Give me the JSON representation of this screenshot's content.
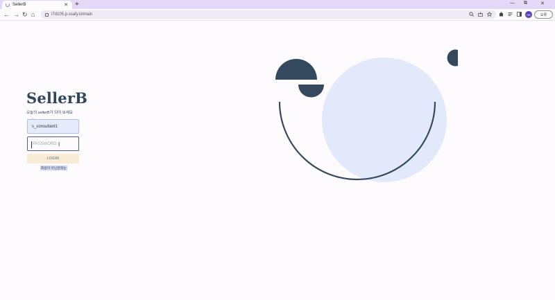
{
  "browser": {
    "tab_title": "SellerB",
    "tab_close": "✕",
    "new_tab": "+",
    "url": "i7d105.p.ssafy.io/main",
    "profile_initials": "RB",
    "update_label": "오류",
    "window_minimize": "—",
    "window_restore": "⧉",
    "window_close": "✕",
    "nav_back": "←",
    "nav_forward": "→",
    "nav_reload": "↻",
    "nav_home": "⌂"
  },
  "login": {
    "brand": "SellerB",
    "tagline": "오늘의 sellerB가 되어 보세요",
    "tiny_mark": "ⓘ",
    "username_value": "s_consultant1",
    "password_placeholder": "PASSWORD",
    "login_button": "LOGIN",
    "signup_link": "회원이 아닌분께는"
  },
  "colors": {
    "accent_navy": "#2f465a",
    "circle_fill": "#e1e9fb",
    "login_button_bg": "#f8ecd4"
  }
}
